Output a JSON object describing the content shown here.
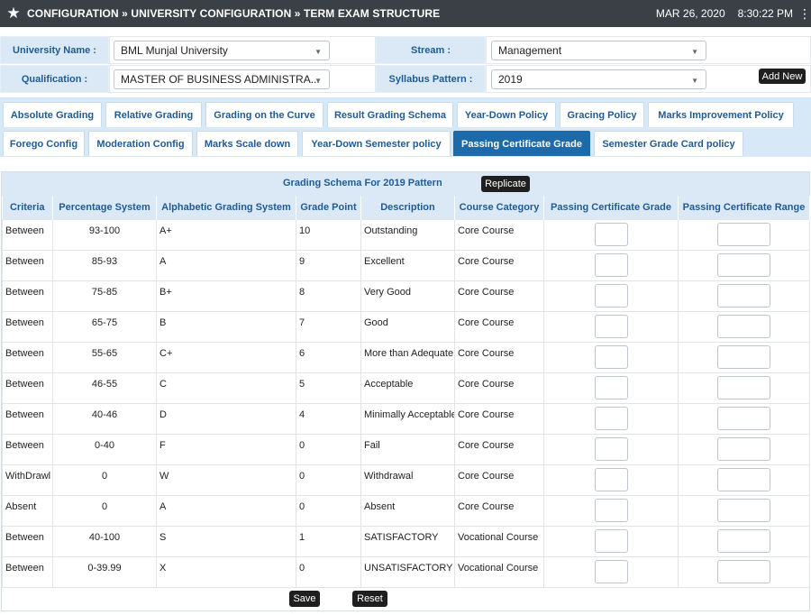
{
  "header": {
    "breadcrumb": "CONFIGURATION » UNIVERSITY CONFIGURATION » TERM EXAM STRUCTURE",
    "date": "MAR 26, 2020",
    "time": "8:30:22 PM",
    "icons": {
      "favorite": "star-icon",
      "menu": "kebab-menu-icon"
    }
  },
  "filters": {
    "university_label": "University Name :",
    "university_value": "BML Munjal University",
    "stream_label": "Stream :",
    "stream_value": "Management",
    "qualification_label": "Qualification :",
    "qualification_value": "MASTER OF BUSINESS ADMINISTRA...",
    "syllabus_label": "Syllabus Pattern :",
    "syllabus_value": "2019",
    "add_new": "Add New"
  },
  "tabs": {
    "row1": [
      "Absolute Grading",
      "Relative Grading",
      "Grading on the Curve",
      "Result Grading Schema",
      "Year-Down Policy",
      "Gracing Policy",
      "Marks Improvement Policy"
    ],
    "row2": [
      "Forego Config",
      "Moderation Config",
      "Marks Scale down",
      "Year-Down Semester policy",
      "Passing Certificate Grade",
      "Semester Grade Card policy"
    ],
    "active": "Passing Certificate Grade"
  },
  "grid": {
    "title": "Grading Schema For 2019 Pattern",
    "replicate": "Replicate",
    "columns": [
      "Criteria",
      "Percentage System",
      "Alphabetic Grading System",
      "Grade Point",
      "Description",
      "Course Category",
      "Passing Certificate Grade",
      "Passing Certificate Range"
    ],
    "rows": [
      [
        "Between",
        "93-100",
        "A+",
        "10",
        "Outstanding",
        "Core Course"
      ],
      [
        "Between",
        "85-93",
        "A",
        "9",
        "Excellent",
        "Core Course"
      ],
      [
        "Between",
        "75-85",
        "B+",
        "8",
        "Very Good",
        "Core Course"
      ],
      [
        "Between",
        "65-75",
        "B",
        "7",
        "Good",
        "Core Course"
      ],
      [
        "Between",
        "55-65",
        "C+",
        "6",
        "More than Adequate",
        "Core Course"
      ],
      [
        "Between",
        "46-55",
        "C",
        "5",
        "Acceptable",
        "Core Course"
      ],
      [
        "Between",
        "40-46",
        "D",
        "4",
        "Minimally Acceptable",
        "Core Course"
      ],
      [
        "Between",
        "0-40",
        "F",
        "0",
        "Fail",
        "Core Course"
      ],
      [
        "WithDrawl",
        "0",
        "W",
        "0",
        "Withdrawal",
        "Core Course"
      ],
      [
        "Absent",
        "0",
        "A",
        "0",
        "Absent",
        "Core Course"
      ],
      [
        "Between",
        "40-100",
        "S",
        "1",
        "SATISFACTORY",
        "Vocational Course"
      ],
      [
        "Between",
        "0-39.99",
        "X",
        "0",
        "UNSATISFACTORY",
        "Vocational Course"
      ]
    ],
    "save": "Save",
    "reset": "Reset"
  }
}
